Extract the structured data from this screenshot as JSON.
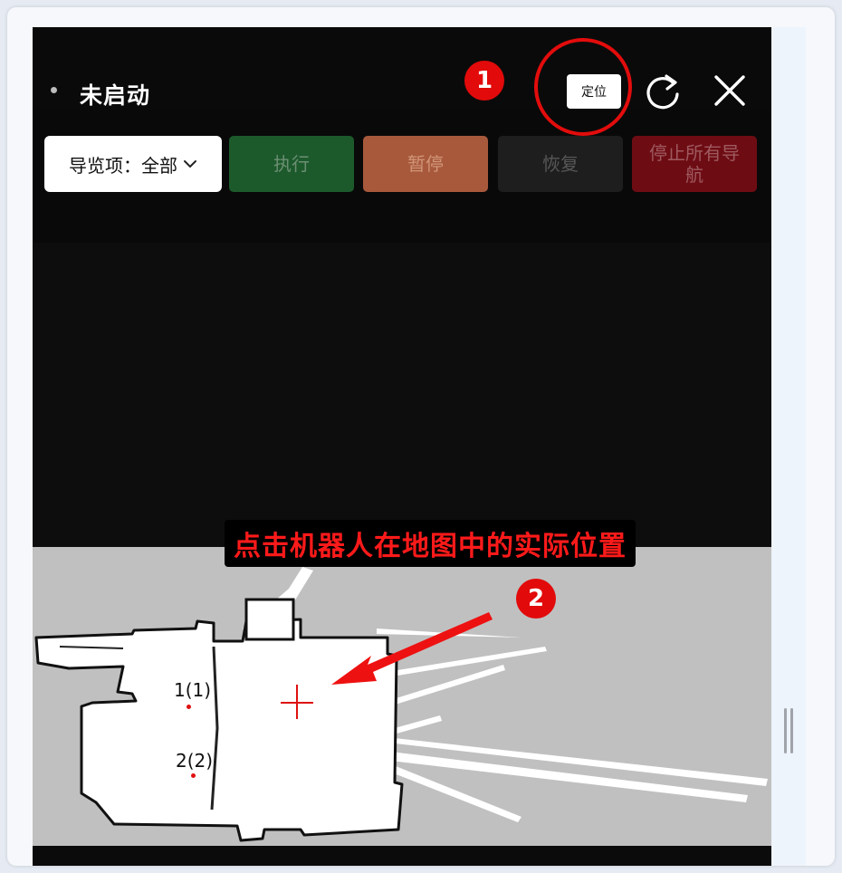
{
  "status": {
    "text": "未启动"
  },
  "header": {
    "locate_label": "定位",
    "step1": "1",
    "refresh_icon": "refresh-icon",
    "close_icon": "close-icon"
  },
  "toolbar": {
    "select_value": "导览项：全部",
    "execute_label": "执行",
    "pause_label": "暂停",
    "resume_label": "恢复",
    "stop_label": "停止所有导航"
  },
  "map": {
    "caption": "点击机器人在地图中的实际位置",
    "step2": "2",
    "waypoints": [
      "1(1)",
      "2(2)"
    ]
  },
  "colors": {
    "accent_red": "#e20a0a",
    "execute_bg": "#1c5a2c",
    "pause_bg": "#a8593c",
    "resume_bg": "#1e1e1e",
    "stop_bg": "#6e0c14"
  }
}
